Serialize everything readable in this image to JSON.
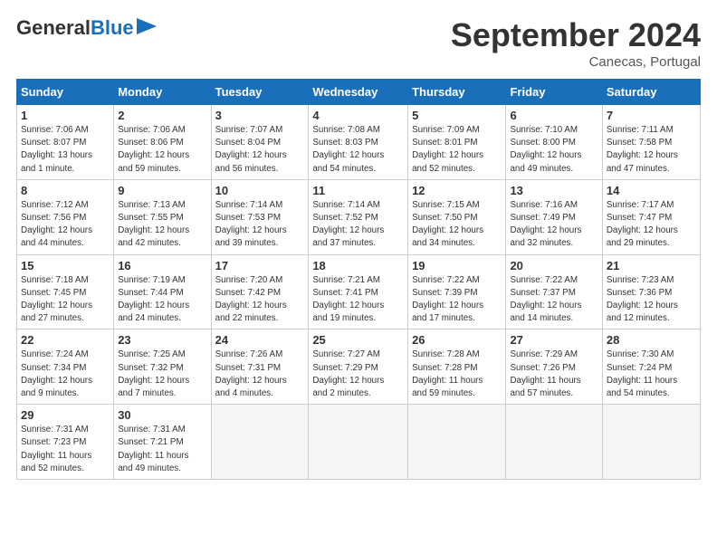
{
  "header": {
    "logo_general": "General",
    "logo_blue": "Blue",
    "month_title": "September 2024",
    "subtitle": "Canecas, Portugal"
  },
  "days_of_week": [
    "Sunday",
    "Monday",
    "Tuesday",
    "Wednesday",
    "Thursday",
    "Friday",
    "Saturday"
  ],
  "weeks": [
    [
      {
        "day": "1",
        "info": "Sunrise: 7:06 AM\nSunset: 8:07 PM\nDaylight: 13 hours\nand 1 minute."
      },
      {
        "day": "2",
        "info": "Sunrise: 7:06 AM\nSunset: 8:06 PM\nDaylight: 12 hours\nand 59 minutes."
      },
      {
        "day": "3",
        "info": "Sunrise: 7:07 AM\nSunset: 8:04 PM\nDaylight: 12 hours\nand 56 minutes."
      },
      {
        "day": "4",
        "info": "Sunrise: 7:08 AM\nSunset: 8:03 PM\nDaylight: 12 hours\nand 54 minutes."
      },
      {
        "day": "5",
        "info": "Sunrise: 7:09 AM\nSunset: 8:01 PM\nDaylight: 12 hours\nand 52 minutes."
      },
      {
        "day": "6",
        "info": "Sunrise: 7:10 AM\nSunset: 8:00 PM\nDaylight: 12 hours\nand 49 minutes."
      },
      {
        "day": "7",
        "info": "Sunrise: 7:11 AM\nSunset: 7:58 PM\nDaylight: 12 hours\nand 47 minutes."
      }
    ],
    [
      {
        "day": "8",
        "info": "Sunrise: 7:12 AM\nSunset: 7:56 PM\nDaylight: 12 hours\nand 44 minutes."
      },
      {
        "day": "9",
        "info": "Sunrise: 7:13 AM\nSunset: 7:55 PM\nDaylight: 12 hours\nand 42 minutes."
      },
      {
        "day": "10",
        "info": "Sunrise: 7:14 AM\nSunset: 7:53 PM\nDaylight: 12 hours\nand 39 minutes."
      },
      {
        "day": "11",
        "info": "Sunrise: 7:14 AM\nSunset: 7:52 PM\nDaylight: 12 hours\nand 37 minutes."
      },
      {
        "day": "12",
        "info": "Sunrise: 7:15 AM\nSunset: 7:50 PM\nDaylight: 12 hours\nand 34 minutes."
      },
      {
        "day": "13",
        "info": "Sunrise: 7:16 AM\nSunset: 7:49 PM\nDaylight: 12 hours\nand 32 minutes."
      },
      {
        "day": "14",
        "info": "Sunrise: 7:17 AM\nSunset: 7:47 PM\nDaylight: 12 hours\nand 29 minutes."
      }
    ],
    [
      {
        "day": "15",
        "info": "Sunrise: 7:18 AM\nSunset: 7:45 PM\nDaylight: 12 hours\nand 27 minutes."
      },
      {
        "day": "16",
        "info": "Sunrise: 7:19 AM\nSunset: 7:44 PM\nDaylight: 12 hours\nand 24 minutes."
      },
      {
        "day": "17",
        "info": "Sunrise: 7:20 AM\nSunset: 7:42 PM\nDaylight: 12 hours\nand 22 minutes."
      },
      {
        "day": "18",
        "info": "Sunrise: 7:21 AM\nSunset: 7:41 PM\nDaylight: 12 hours\nand 19 minutes."
      },
      {
        "day": "19",
        "info": "Sunrise: 7:22 AM\nSunset: 7:39 PM\nDaylight: 12 hours\nand 17 minutes."
      },
      {
        "day": "20",
        "info": "Sunrise: 7:22 AM\nSunset: 7:37 PM\nDaylight: 12 hours\nand 14 minutes."
      },
      {
        "day": "21",
        "info": "Sunrise: 7:23 AM\nSunset: 7:36 PM\nDaylight: 12 hours\nand 12 minutes."
      }
    ],
    [
      {
        "day": "22",
        "info": "Sunrise: 7:24 AM\nSunset: 7:34 PM\nDaylight: 12 hours\nand 9 minutes."
      },
      {
        "day": "23",
        "info": "Sunrise: 7:25 AM\nSunset: 7:32 PM\nDaylight: 12 hours\nand 7 minutes."
      },
      {
        "day": "24",
        "info": "Sunrise: 7:26 AM\nSunset: 7:31 PM\nDaylight: 12 hours\nand 4 minutes."
      },
      {
        "day": "25",
        "info": "Sunrise: 7:27 AM\nSunset: 7:29 PM\nDaylight: 12 hours\nand 2 minutes."
      },
      {
        "day": "26",
        "info": "Sunrise: 7:28 AM\nSunset: 7:28 PM\nDaylight: 11 hours\nand 59 minutes."
      },
      {
        "day": "27",
        "info": "Sunrise: 7:29 AM\nSunset: 7:26 PM\nDaylight: 11 hours\nand 57 minutes."
      },
      {
        "day": "28",
        "info": "Sunrise: 7:30 AM\nSunset: 7:24 PM\nDaylight: 11 hours\nand 54 minutes."
      }
    ],
    [
      {
        "day": "29",
        "info": "Sunrise: 7:31 AM\nSunset: 7:23 PM\nDaylight: 11 hours\nand 52 minutes."
      },
      {
        "day": "30",
        "info": "Sunrise: 7:31 AM\nSunset: 7:21 PM\nDaylight: 11 hours\nand 49 minutes."
      },
      null,
      null,
      null,
      null,
      null
    ]
  ]
}
